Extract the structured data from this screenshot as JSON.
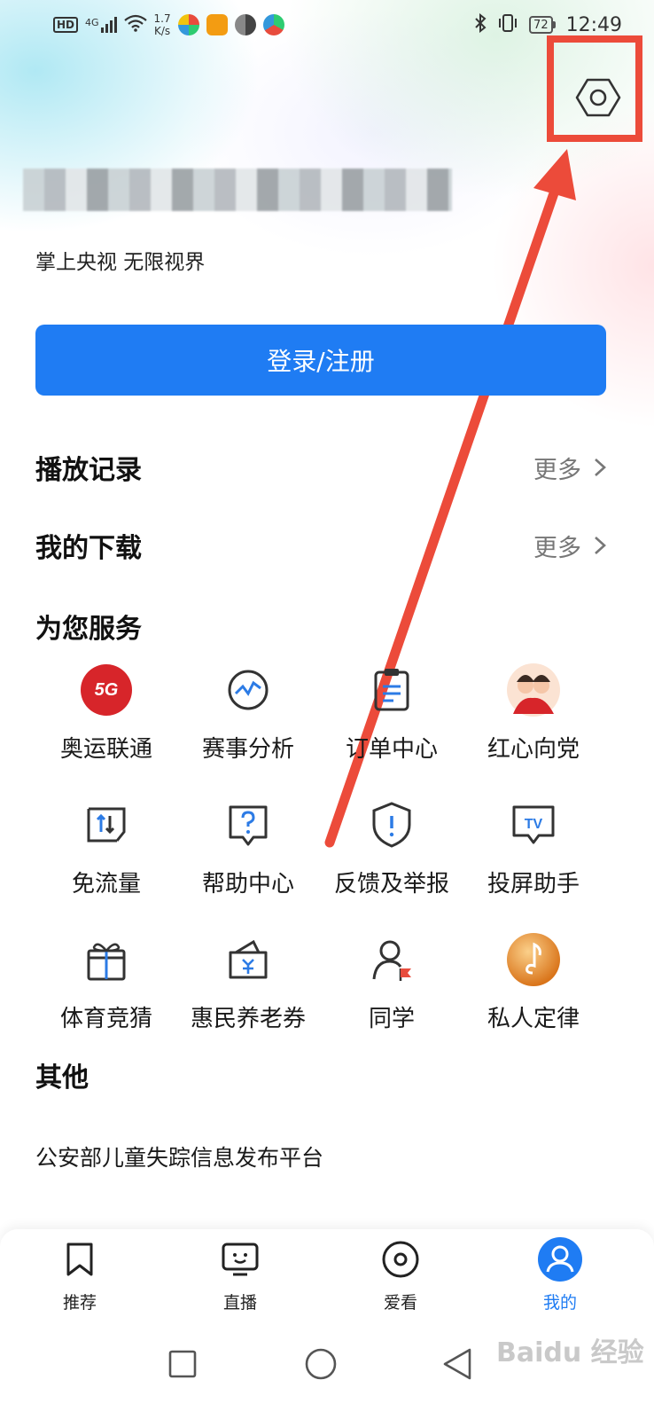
{
  "status_bar": {
    "hd": "HD",
    "network": "4G",
    "speed_value": "1.7",
    "speed_unit": "K/s",
    "battery": "72",
    "time": "12:49"
  },
  "header": {
    "slogan": "掌上央视 无限视界",
    "login_button": "登录/注册",
    "settings_icon": "gear-hexagon-icon"
  },
  "history": {
    "title": "播放记录",
    "more": "更多"
  },
  "downloads": {
    "title": "我的下载",
    "more": "更多"
  },
  "services": {
    "title": "为您服务",
    "items": [
      {
        "label": "奥运联通",
        "icon": "5g-badge-icon"
      },
      {
        "label": "赛事分析",
        "icon": "chart-circle-icon"
      },
      {
        "label": "订单中心",
        "icon": "clipboard-icon"
      },
      {
        "label": "红心向党",
        "icon": "people-avatar-icon"
      },
      {
        "label": "免流量",
        "icon": "data-transfer-icon"
      },
      {
        "label": "帮助中心",
        "icon": "question-bubble-icon"
      },
      {
        "label": "反馈及举报",
        "icon": "shield-alert-icon"
      },
      {
        "label": "投屏助手",
        "icon": "tv-cast-icon"
      },
      {
        "label": "体育竞猜",
        "icon": "gift-box-icon"
      },
      {
        "label": "惠民养老券",
        "icon": "wallet-yuan-icon"
      },
      {
        "label": "同学",
        "icon": "person-flag-icon"
      },
      {
        "label": "私人定律",
        "icon": "music-note-icon"
      }
    ]
  },
  "other": {
    "title": "其他",
    "link": "公安部儿童失踪信息发布平台"
  },
  "bottom_nav": {
    "items": [
      {
        "label": "推荐",
        "icon": "bookmark-icon"
      },
      {
        "label": "直播",
        "icon": "tv-face-icon"
      },
      {
        "label": "爱看",
        "icon": "target-circle-icon"
      },
      {
        "label": "我的",
        "icon": "user-icon"
      }
    ],
    "active": "我的"
  },
  "watermark": "Baidu 经验",
  "colors": {
    "accent": "#1f7cf3",
    "annotation": "#ec4b3a"
  }
}
